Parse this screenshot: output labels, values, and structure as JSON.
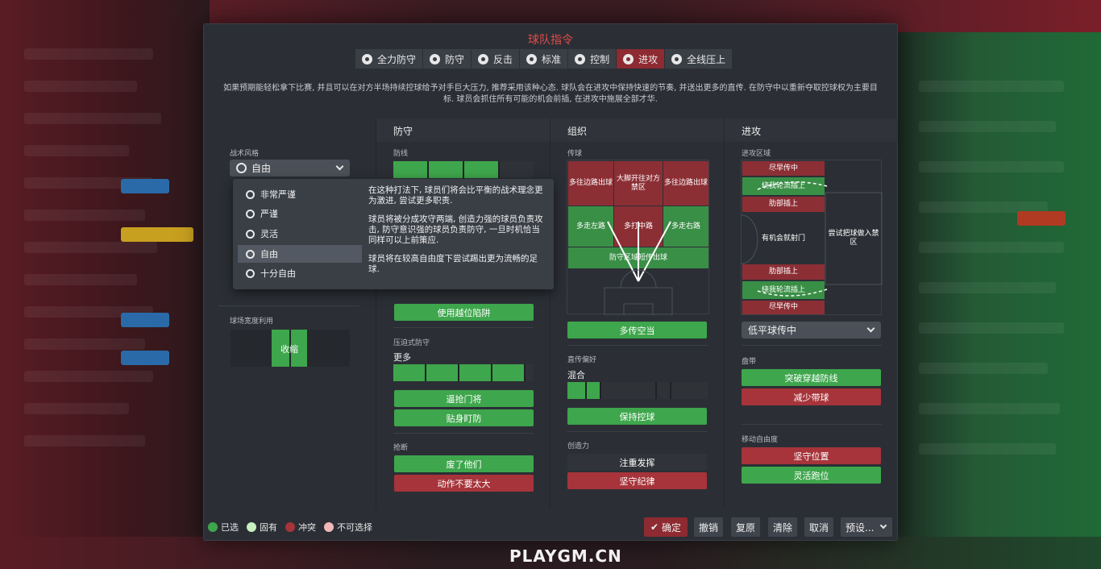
{
  "title": "球队指令",
  "tabs": [
    {
      "label": "全力防守",
      "icon": "heart-shield-icon"
    },
    {
      "label": "防守",
      "icon": "shield-icon"
    },
    {
      "label": "反击",
      "icon": "counter-arrow-icon"
    },
    {
      "label": "标准",
      "icon": "standard-icon"
    },
    {
      "label": "控制",
      "icon": "control-cube-icon"
    },
    {
      "label": "进攻",
      "icon": "attack-arrow-icon",
      "active": true
    },
    {
      "label": "全线压上",
      "icon": "all-out-attack-icon"
    }
  ],
  "description": "如果预期能轻松拿下比赛, 并且可以在对方半场持续控球给予对手巨大压力, 推荐采用该种心态. 球队会在进攻中保持快速的节奏, 并送出更多的直传. 在防守中以重新夺取控球权为主要目标. 球员会抓住所有可能的机会前插, 在进攻中施展全部才华.",
  "columns": {
    "defense": "防守",
    "organize": "组织",
    "attack": "进攻"
  },
  "tactical_style": {
    "label": "战术风格",
    "value": "自由",
    "options": [
      {
        "label": "非常严谨",
        "selected": false
      },
      {
        "label": "严谨",
        "selected": false
      },
      {
        "label": "灵活",
        "selected": false
      },
      {
        "label": "自由",
        "selected": true
      },
      {
        "label": "十分自由",
        "selected": false
      }
    ],
    "tooltip": [
      "在这种打法下, 球员们将会比平衡的战术理念更为激进, 尝试更多职责.",
      "球员将被分成攻守两端, 创造力强的球员负责攻击, 防守意识强的球员负责防守, 一旦时机恰当同样可以上前策应.",
      "球员将在较高自由度下尝试踢出更为流畅的足球."
    ]
  },
  "width": {
    "label": "球场宽度利用",
    "value": "收缩"
  },
  "defense_line": {
    "label": "防线",
    "offside_button": "使用越位陷阱"
  },
  "pressing": {
    "label": "压迫式防守",
    "value": "更多",
    "buttons": [
      "逼抢门将",
      "贴身盯防"
    ]
  },
  "tackling": {
    "label": "抢断",
    "buttons": [
      "废了他们",
      "动作不要太大"
    ]
  },
  "passing": {
    "label": "传球",
    "cells": [
      "多往边路出球",
      "大脚开往对方禁区",
      "多往边路出球",
      "多走左路",
      "多打中路",
      "多走右路",
      "防守区域短传出球"
    ],
    "button": "多传空当"
  },
  "pass_pref": {
    "label": "直传偏好",
    "value": "混合",
    "button": "保持控球"
  },
  "creativity": {
    "label": "创造力",
    "buttons": [
      "注重发挥",
      "坚守纪律"
    ]
  },
  "attack_zone": {
    "label": "进攻区域",
    "cells": [
      "尽早传中",
      "绕我轮流插上",
      "肋部插上",
      "有机会就射门",
      "尝试把球做入禁区",
      "肋部插上",
      "绕我轮流插上",
      "尽早传中"
    ],
    "select": "低平球传中"
  },
  "dribble": {
    "label": "盘带",
    "buttons": [
      "突破穿越防线",
      "减少带球"
    ]
  },
  "movement": {
    "label": "移动自由度",
    "buttons": [
      "坚守位置",
      "灵活跑位"
    ]
  },
  "legend": [
    {
      "label": "已选",
      "color": "#3ea64c"
    },
    {
      "label": "固有",
      "color": "#c8f0c0"
    },
    {
      "label": "冲突",
      "color": "#a6343a"
    },
    {
      "label": "不可选择",
      "color": "#f0b8b8"
    }
  ],
  "footer": {
    "ok": "确定",
    "undo": "撤销",
    "redo": "复原",
    "clear": "清除",
    "cancel": "取消",
    "preset": "预设..."
  },
  "watermark": "PLAYGM.CN",
  "colors": {
    "accent_red": "#8e2a31",
    "selected_green": "#3ea64c",
    "conflict_red": "#a6343a",
    "title_red": "#e24a4a"
  }
}
